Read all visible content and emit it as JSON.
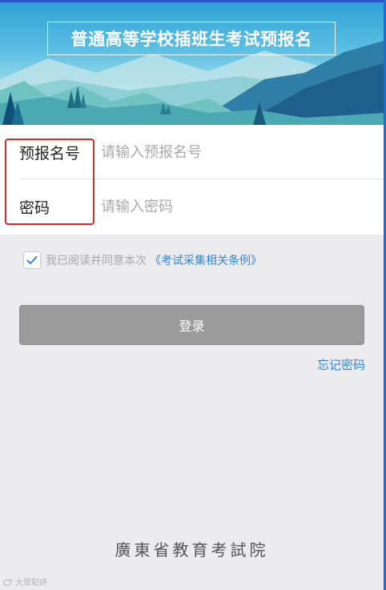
{
  "header": {
    "title": "普通高等学校插班生考试预报名"
  },
  "form": {
    "registration_number": {
      "label": "预报名号",
      "placeholder": "请输入预报名号"
    },
    "password": {
      "label": "密码",
      "placeholder": "请输入密码"
    }
  },
  "agreement": {
    "checked": true,
    "text": "我已阅读并同意本次",
    "link_text": "《考试采集相关条例》"
  },
  "actions": {
    "login_label": "登录",
    "forgot_password_label": "忘记密码"
  },
  "footer": {
    "organization": "廣東省教育考試院",
    "watermark": "大眾點評"
  },
  "colors": {
    "accent_blue": "#2e86d6",
    "login_button": "#9b9b9b",
    "highlight_red": "#d62d2d",
    "page_background": "#ececee"
  }
}
